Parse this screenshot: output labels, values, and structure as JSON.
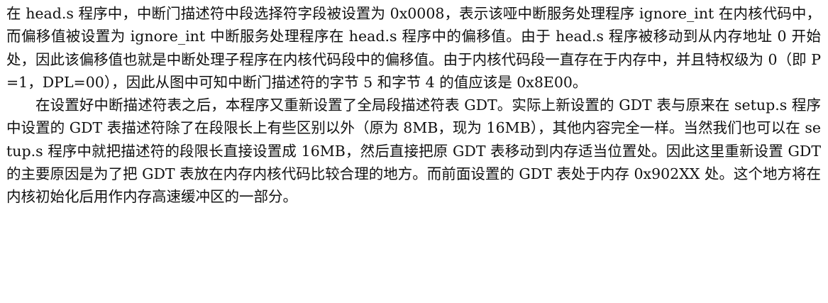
{
  "document": {
    "paragraphs": [
      {
        "id": "p1",
        "text": "在 head.s 程序中，中断门描述符中段选择符字段被设置为 0x0008，表示该哑中断服务处理程序 ignore_int 在内核代码中，而偏移值被设置为 ignore_int 中断服务处理程序在 head.s 程序中的偏移值。由于 head.s 程序被移动到从内存地址 0 开始处，因此该偏移值也就是中断处理子程序在内核代码段中的偏移值。由于内核代码段一直存在于内存中，并且特权级为 0（即 P=1，DPL=00），因此从图中可知中断门描述符的字节 5 和字节 4 的值应该是 0x8E00。"
      },
      {
        "id": "p2",
        "text": "在设置好中断描述符表之后，本程序又重新设置了全局段描述符表 GDT。实际上新设置的 GDT 表与原来在 setup.s 程序中设置的 GDT 表描述符除了在段限长上有些区别以外（原为 8MB，现为 16MB），其他内容完全一样。当然我们也可以在 setup.s 程序中就把描述符的段限长直接设置成 16MB，然后直接把原 GDT 表移动到内存适当位置处。因此这里重新设置 GDT 的主要原因是为了把 GDT 表放在内存内核代码比较合理的地方。而前面设置的 GDT 表处于内存 0x902XX 处。这个地方将在内核初始化后用作内存高速缓冲区的一部分。"
      }
    ]
  }
}
